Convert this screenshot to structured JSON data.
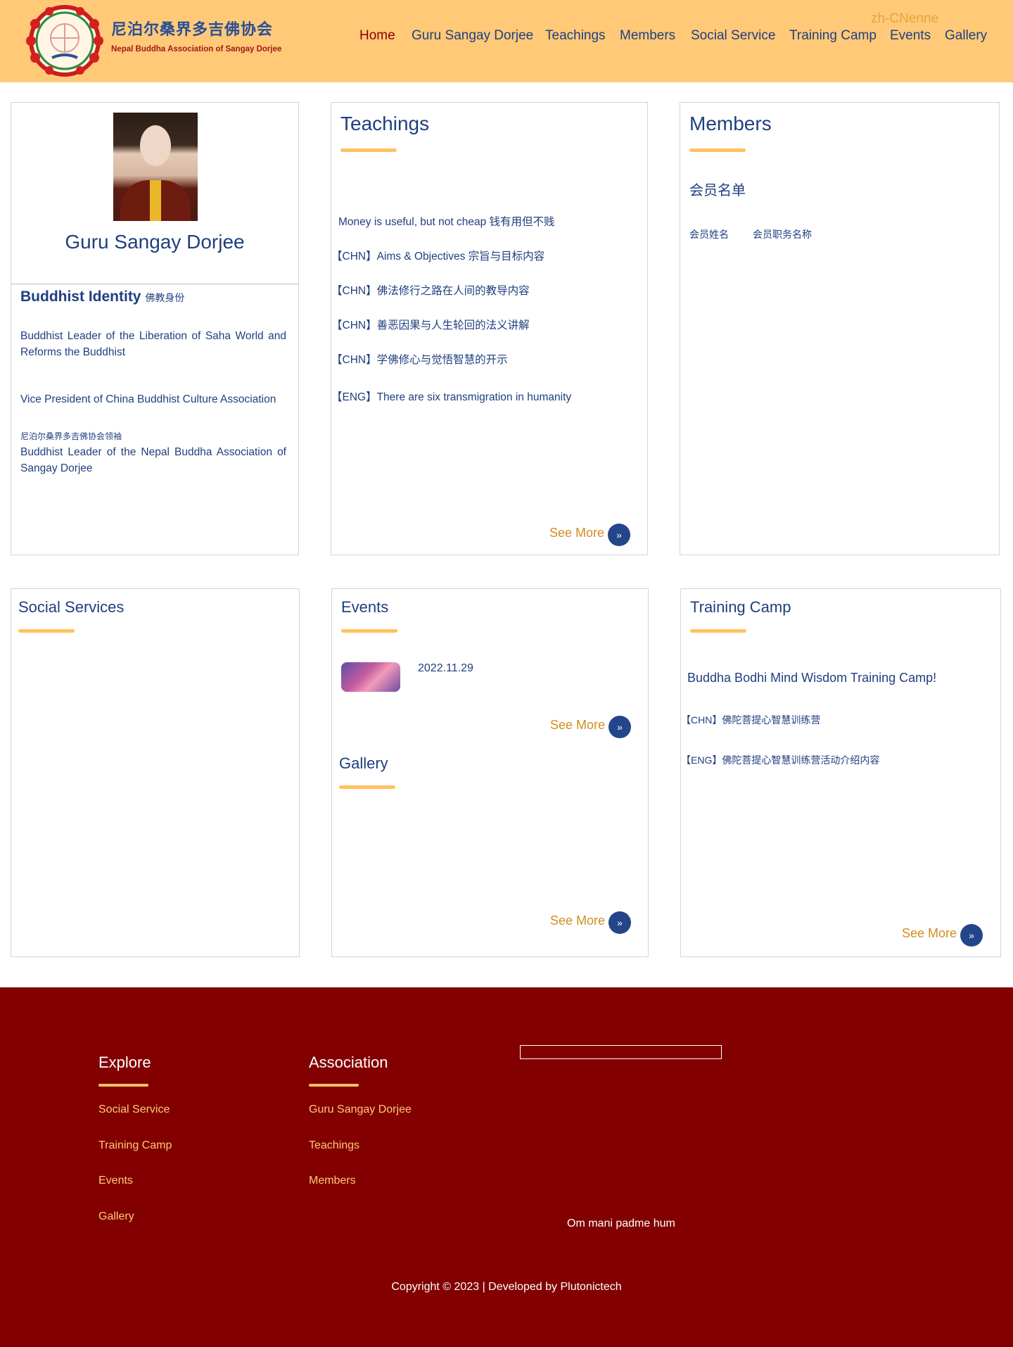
{
  "header": {
    "brand_cn": "尼泊尔桑界多吉佛协会",
    "brand_en": "Nepal Buddha Association of Sangay Dorjee",
    "lang": [
      "zh-CN",
      "en",
      "ne"
    ],
    "nav": [
      "Home",
      "Guru Sangay Dorjee",
      "Teachings",
      "Members",
      "Social Service",
      "Training Camp",
      "Events",
      "Gallery"
    ]
  },
  "guru": {
    "name": "Guru Sangay Dorjee",
    "identity_title": "Buddhist Identity",
    "identity_title_cn": "佛教身份",
    "para1": "Buddhist Leader of the Liberation of Saha World and Reforms the Buddhist",
    "para2": "Vice President of China Buddhist Culture Association",
    "para3_cn": "尼泊尔桑界多吉佛协会领袖",
    "para3": "Buddhist Leader of the Nepal Buddha Association of Sangay Dorjee"
  },
  "teachings": {
    "title": "Teachings",
    "items": [
      "Money is useful, but not cheap 钱有用但不贱",
      "【CHN】Aims & Objectives 宗旨与目标内容",
      "【CHN】佛法修行之路在人间的教导内容",
      "【CHN】善恶因果与人生轮回的法义讲解",
      "【CHN】学佛修心与觉悟智慧的开示",
      "【ENG】There are six transmigration in humanity"
    ],
    "see_more": "See More"
  },
  "members": {
    "title": "Members",
    "subtitle": "会员名单",
    "row": [
      "会员姓名",
      "会员职务名称"
    ]
  },
  "social": {
    "title": "Social Services"
  },
  "events": {
    "title": "Events",
    "date": "2022.11.29",
    "see_more": "See More"
  },
  "gallery": {
    "title": "Gallery",
    "see_more": "See More"
  },
  "training": {
    "title": "Training Camp",
    "heading": "Buddha Bodhi Mind Wisdom Training Camp!",
    "items": [
      "【CHN】佛陀菩提心智慧训练营",
      "【ENG】佛陀菩提心智慧训练营活动介绍内容"
    ],
    "see_more": "See More"
  },
  "footer": {
    "explore_title": "Explore",
    "explore_links": [
      "Social Service",
      "Training Camp",
      "Events",
      "Gallery"
    ],
    "assoc_title": "Association",
    "assoc_links": [
      "Guru Sangay Dorjee",
      "Teachings",
      "Members"
    ],
    "om": "Om mani padme hum",
    "copyright": "Copyright © 2023 | Developed by Plutonictech"
  },
  "colors": {
    "header_bg": "#ffc978",
    "footer_bg": "#820000",
    "accent": "#ffc260",
    "text_blue": "#1f3f7f",
    "see_more": "#d08e22"
  }
}
